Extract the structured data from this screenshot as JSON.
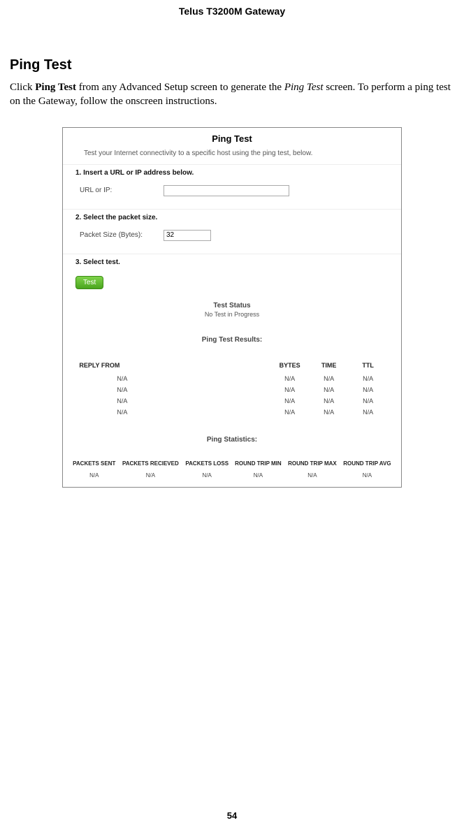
{
  "running_head": "Telus T3200M Gateway",
  "section_title": "Ping Test",
  "body_prefix": "Click ",
  "body_bold": "Ping Test",
  "body_mid": " from any Advanced Setup screen to generate the ",
  "body_ital": "Ping Test",
  "body_suffix": " screen. To perform a ping test on the Gateway, follow the onscreen instructions.",
  "page_number": "54",
  "shot": {
    "title": "Ping Test",
    "intro": "Test your Internet connectivity to a specific host using the ping test, below.",
    "step1": "1. Insert a URL or IP address below.",
    "url_label": "URL or IP:",
    "url_value": "",
    "step2": "2. Select the packet size.",
    "packet_label": "Packet Size (Bytes):",
    "packet_value": "32",
    "step3": "3. Select test.",
    "test_btn": "Test",
    "status_head": "Test Status",
    "status_text": "No Test in Progress",
    "results_head": "Ping Test Results:",
    "results_cols": {
      "reply": "REPLY FROM",
      "bytes": "BYTES",
      "time": "TIME",
      "ttl": "TTL"
    },
    "results_rows": [
      {
        "reply": "N/A",
        "bytes": "N/A",
        "time": "N/A",
        "ttl": "N/A"
      },
      {
        "reply": "N/A",
        "bytes": "N/A",
        "time": "N/A",
        "ttl": "N/A"
      },
      {
        "reply": "N/A",
        "bytes": "N/A",
        "time": "N/A",
        "ttl": "N/A"
      },
      {
        "reply": "N/A",
        "bytes": "N/A",
        "time": "N/A",
        "ttl": "N/A"
      }
    ],
    "stats_head": "Ping Statistics:",
    "stats_cols": {
      "sent": "PACKETS SENT",
      "recv": "PACKETS RECIEVED",
      "loss": "PACKETS LOSS",
      "rtmin": "ROUND TRIP MIN",
      "rtmax": "ROUND TRIP MAX",
      "rtavg": "ROUND TRIP AVG"
    },
    "stats_row": {
      "sent": "N/A",
      "recv": "N/A",
      "loss": "N/A",
      "rtmin": "N/A",
      "rtmax": "N/A",
      "rtavg": "N/A"
    }
  }
}
